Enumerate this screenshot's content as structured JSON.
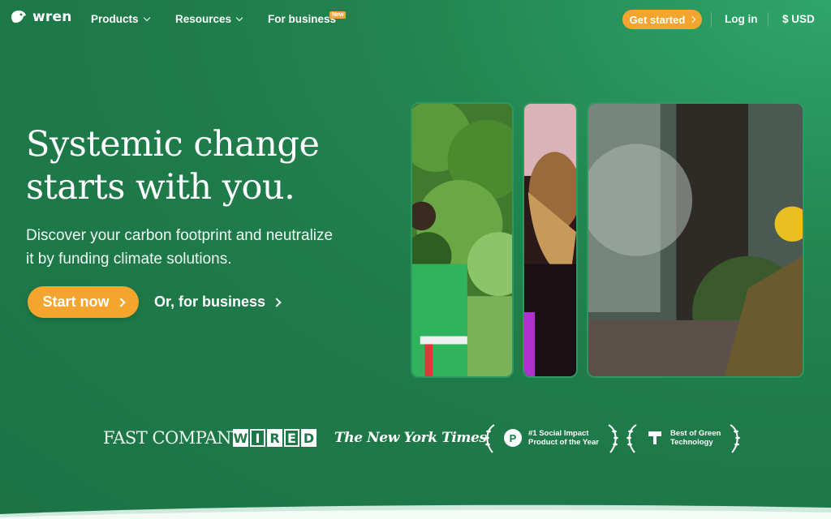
{
  "nav": {
    "brand": "wren",
    "items": [
      {
        "label": "Products"
      },
      {
        "label": "Resources"
      },
      {
        "label": "For business"
      }
    ],
    "new_badge": "New",
    "get_started": "Get started",
    "login": "Log in",
    "currency": "$ USD"
  },
  "hero": {
    "headline_line1": "Systemic change",
    "headline_line2": "starts with you.",
    "subtext_line1": "Discover your carbon footprint and neutralize",
    "subtext_line2": "it by funding climate solutions.",
    "primary_cta": "Start now",
    "secondary_cta": "Or, for business"
  },
  "press": {
    "fast_company": "FAST COMPANY",
    "wired": [
      "W",
      "I",
      "R",
      "E",
      "D"
    ],
    "nyt": "The New York Times",
    "award1": {
      "icon": "P",
      "line1": "#1 Social Impact",
      "line2": "Product of the Year"
    },
    "award2": {
      "line1": "Best of Green",
      "line2": "Technology"
    }
  },
  "colors": {
    "accent_orange": "#f4a52d",
    "bg_green": "#1e7a49"
  }
}
